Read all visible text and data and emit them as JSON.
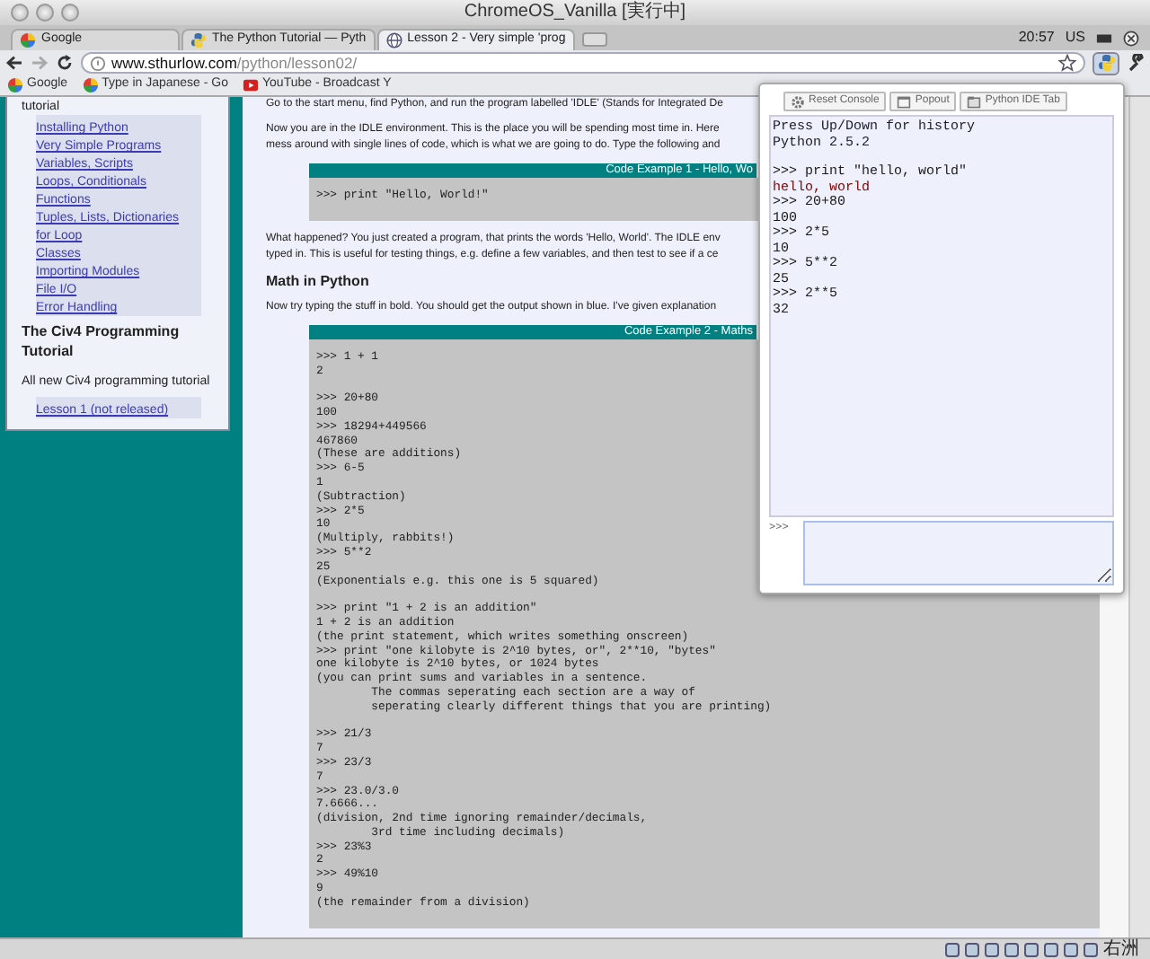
{
  "window": {
    "title": "ChromeOS_Vanilla [実行中]"
  },
  "tabs": [
    {
      "title": "Google",
      "kind": "google",
      "selected": false
    },
    {
      "title": "The Python Tutorial — Pyth",
      "kind": "python",
      "selected": false
    },
    {
      "title": "Lesson 2 - Very simple 'prog",
      "kind": "globe",
      "selected": true
    }
  ],
  "tray": {
    "time": "20:57",
    "layout": "US"
  },
  "address_bar": {
    "host": "www.sthurlow.com",
    "path": "/python/lesson02/"
  },
  "bookmarks": [
    {
      "label": "Google",
      "kind": "google"
    },
    {
      "label": "Type in Japanese - Go",
      "kind": "google"
    },
    {
      "label": "YouTube - Broadcast Y",
      "kind": "youtube"
    }
  ],
  "sidebar": {
    "heading_tail": "tutorial",
    "links": [
      "Installing Python",
      "Very Simple Programs",
      "Variables, Scripts",
      "Loops, Conditionals",
      "Functions",
      "Tuples, Lists, Dictionaries",
      "for Loop",
      "Classes",
      "Importing Modules",
      "File I/O",
      "Error Handling"
    ],
    "section_title": "The Civ4 Programming Tutorial",
    "section_text": "All new Civ4 programming tutorial",
    "section_links": [
      "Lesson 1 (not released)"
    ]
  },
  "article": [
    {
      "kind": "para",
      "lines": [
        "Go to the start menu, find Python, and run the program labelled 'IDLE' (Stands for Integrated De"
      ]
    },
    {
      "kind": "para",
      "lines": [
        "Now you are in the IDLE environment. This is the place you will be spending most time in. Here",
        "mess around with single lines of code, which is what we are going to do. Type the following and"
      ]
    },
    {
      "kind": "code",
      "title": "Code Example 1 - Hello, Wo",
      "groups": [
        [
          ">>> print \"Hello, World!\""
        ]
      ]
    },
    {
      "kind": "para",
      "lines": [
        "What happened? You just created a program, that prints the words 'Hello, World'. The IDLE env",
        "typed in. This is useful for testing things, e.g. define a few variables, and then test to see if a ce"
      ]
    },
    {
      "kind": "heading",
      "text": "Math in Python"
    },
    {
      "kind": "para",
      "lines": [
        "Now try typing the stuff in bold. You should get the output shown in blue. I've given explanation"
      ]
    },
    {
      "kind": "code",
      "title": "Code Example 2 - Maths",
      "groups": [
        [
          ">>> 1 + 1",
          "2"
        ],
        [
          ">>> 20+80",
          "100",
          ">>> 18294+449566",
          "467860",
          "(These are additions)",
          ">>> 6-5",
          "1",
          "(Subtraction)",
          ">>> 2*5",
          "10",
          "(Multiply, rabbits!)",
          ">>> 5**2",
          "25",
          "(Exponentials e.g. this one is 5 squared)"
        ],
        [
          ">>> print \"1 + 2 is an addition\"",
          "1 + 2 is an addition",
          "(the print statement, which writes something onscreen)",
          ">>> print \"one kilobyte is 2^10 bytes, or\", 2**10, \"bytes\"",
          "one kilobyte is 2^10 bytes, or 1024 bytes",
          "(you can print sums and variables in a sentence.",
          "        The commas seperating each section are a way of",
          "        seperating clearly different things that you are printing)"
        ],
        [
          ">>> 21/3",
          "7",
          ">>> 23/3",
          "7",
          ">>> 23.0/3.0",
          "7.6666...",
          "(division, 2nd time ignoring remainder/decimals,",
          "        3rd time including decimals)",
          ">>> 23%3",
          "2",
          ">>> 49%10",
          "9",
          "(the remainder from a division)"
        ]
      ]
    }
  ],
  "console_popup": {
    "buttons": [
      {
        "label": "Reset Console",
        "kind": "gear"
      },
      {
        "label": "Popout",
        "kind": "window"
      },
      {
        "label": "Python IDE Tab",
        "kind": "tab"
      }
    ],
    "output": [
      [
        {
          "text": "Press Up/Down for history",
          "kind": "info"
        },
        {
          "text": "Python 2.5.2",
          "kind": "info"
        }
      ],
      [
        {
          "text": ">>> print \"hello, world\"",
          "kind": "input"
        },
        {
          "text": "hello, world",
          "kind": "stdout"
        },
        {
          "text": ">>> 20+80",
          "kind": "input"
        },
        {
          "text": "100",
          "kind": "result"
        },
        {
          "text": ">>> 2*5",
          "kind": "input"
        },
        {
          "text": "10",
          "kind": "result"
        },
        {
          "text": ">>> 5**2",
          "kind": "input"
        },
        {
          "text": "25",
          "kind": "result"
        },
        {
          "text": ">>> 2**5",
          "kind": "input"
        },
        {
          "text": "32",
          "kind": "result"
        }
      ]
    ],
    "prompt": ">>>"
  },
  "status_bar": {
    "ime": "右洲"
  }
}
